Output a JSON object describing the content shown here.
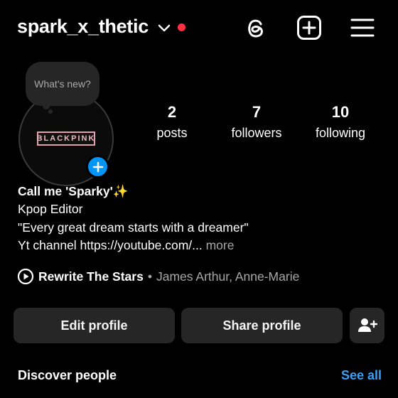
{
  "header": {
    "username": "spark_x_thetic",
    "icons": [
      "chevron-down-icon",
      "threads-icon",
      "create-plus-icon",
      "menu-icon"
    ],
    "notification_color": "#ff3040"
  },
  "note_bubble": {
    "text": "What's new?"
  },
  "avatar": {
    "logo_text": "BLACKPINK"
  },
  "stats": {
    "posts": {
      "value": "2",
      "label": "posts"
    },
    "followers": {
      "value": "7",
      "label": "followers"
    },
    "following": {
      "value": "10",
      "label": "following"
    }
  },
  "bio": {
    "name": "Call me 'Sparky'✨",
    "category": "Kpop Editor",
    "quote": "\"Every great dream starts with a dreamer\"",
    "link_line": "Yt channel https://youtube.com/...",
    "more_label": " more"
  },
  "music": {
    "song": "Rewrite The Stars",
    "separator": "•",
    "artists": "James Arthur, Anne-Marie"
  },
  "actions": {
    "edit_profile": "Edit profile",
    "share_profile": "Share profile"
  },
  "discover": {
    "title": "Discover people",
    "see_all": "See all",
    "accent_color": "#3aa0f5"
  }
}
